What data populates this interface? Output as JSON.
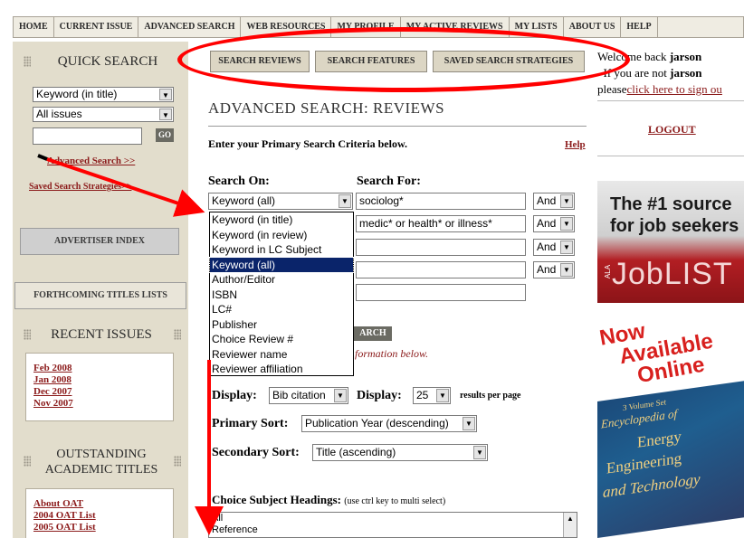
{
  "nav": [
    "HOME",
    "CURRENT ISSUE",
    "ADVANCED SEARCH",
    "WEB RESOURCES",
    "MY PROFILE",
    "MY ACTIVE REVIEWS",
    "MY LISTS",
    "ABOUT US",
    "HELP"
  ],
  "sidebar": {
    "quick_search_title": "QUICK SEARCH",
    "qs_field": "Keyword (in title)",
    "qs_scope": "All issues",
    "qs_input": "",
    "go_label": "GO",
    "advanced_link": "Advanced Search >>",
    "saved_link": "Saved Search Strategies>>",
    "advertiser_index": "ADVERTISER INDEX",
    "forthcoming": "FORTHCOMING TITLES LISTS",
    "recent_issues_title": "RECENT ISSUES",
    "recent_issues": [
      "Feb 2008",
      "Jan 2008",
      "Dec 2007",
      "Nov 2007"
    ],
    "oat_title_line1": "OUTSTANDING",
    "oat_title_line2": "ACADEMIC TITLES",
    "oat_links": [
      "About OAT",
      "2004 OAT List",
      "2005 OAT List"
    ]
  },
  "subtabs": [
    "SEARCH REVIEWS",
    "SEARCH FEATURES",
    "SAVED SEARCH STRATEGIES"
  ],
  "main": {
    "title": "ADVANCED SEARCH: REVIEWS",
    "instruction": "Enter your Primary Search Criteria below.",
    "help": "Help",
    "search_on_label": "Search On:",
    "search_for_label": "Search For:",
    "rows": [
      {
        "field": "Keyword (all)",
        "value": "sociolog*",
        "op": "And"
      },
      {
        "field": "",
        "value": "medic* or health* or illness*",
        "op": "And"
      },
      {
        "field": "",
        "value": "",
        "op": "And"
      },
      {
        "field": "",
        "value": "",
        "op": "And"
      },
      {
        "field": "",
        "value": "",
        "op": ""
      }
    ],
    "dropdown_options": [
      "Keyword (in title)",
      "Keyword (in review)",
      "Keyword in LC Subject",
      "Keyword (all)",
      "Author/Editor",
      "ISBN",
      "LC#",
      "Publisher",
      "Choice Review #",
      "Reviewer name",
      "Reviewer affiliation"
    ],
    "dropdown_selected_index": 3,
    "search_btn_partial": "ARCH",
    "info_partial": "formation below.",
    "display_label": "Display:",
    "display_value": "Bib citation",
    "display2_label": "Display:",
    "display2_value": "25",
    "results_per_page": "results per page",
    "primary_sort_label": "Primary Sort:",
    "primary_sort_value": "Publication Year (descending)",
    "secondary_sort_label": "Secondary Sort:",
    "secondary_sort_value": "Title (ascending)",
    "subject_headings_label": "Choice Subject Headings:",
    "subject_headings_hint": "(use ctrl key to multi select)",
    "subject_headings_items": [
      "All",
      "Reference"
    ]
  },
  "right": {
    "welcome": "Welcome back",
    "user": "jarson",
    "not_user": "If you are not",
    "please": "please",
    "signout": "click here to sign ou",
    "logout": "LOGOUT"
  },
  "ads": {
    "ad1_line1": "The #1 source",
    "ad1_line2": "for job seekers",
    "ad1_brand": "JobLIST",
    "ad1_ala": "ALA",
    "ad2_line1": "Now",
    "ad2_line2": "Available",
    "ad2_line3": "Online",
    "ad2_set": "3 Volume Set",
    "ad2_book1": "Encyclopedia of",
    "ad2_book2": "Energy",
    "ad2_book3": "Engineering",
    "ad2_book4": "and Technology"
  },
  "colors": {
    "accent_red": "#8b1a1a",
    "annotation_red": "#ff0000",
    "sidebar_bg": "#e2ddcc",
    "selection_blue": "#0a246a"
  }
}
